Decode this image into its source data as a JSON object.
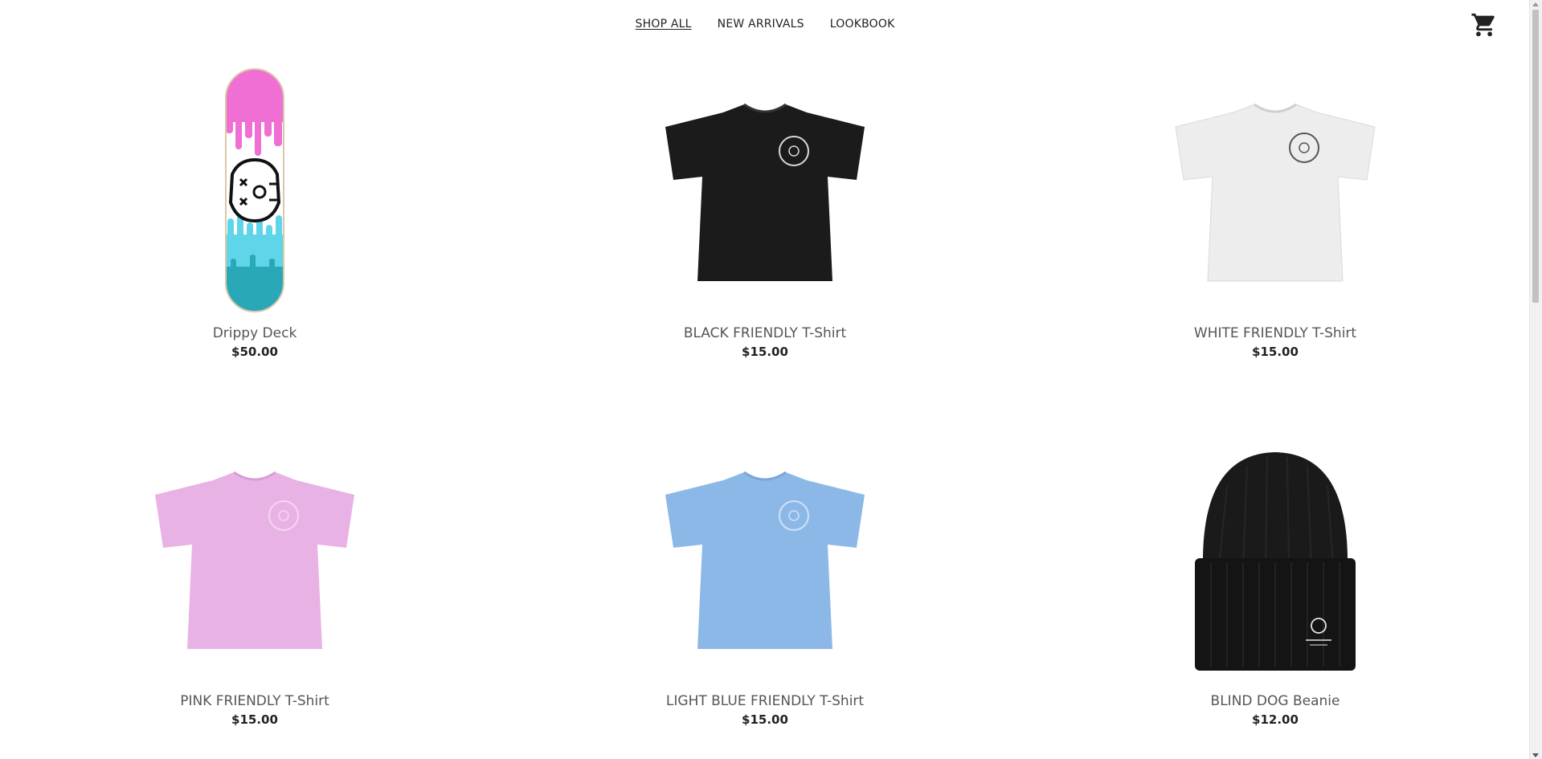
{
  "nav": {
    "items": [
      {
        "label": "SHOP ALL",
        "active": true
      },
      {
        "label": "NEW ARRIVALS",
        "active": false
      },
      {
        "label": "LOOKBOOK",
        "active": false
      }
    ],
    "cart_icon": "shopping-cart-icon"
  },
  "products": [
    {
      "name": "Drippy Deck",
      "price": "$50.00",
      "image": "skateboard-deck",
      "color": "#f06fd4"
    },
    {
      "name": "BLACK FRIENDLY T-Shirt",
      "price": "$15.00",
      "image": "tshirt",
      "color": "#1b1b1b"
    },
    {
      "name": "WHITE FRIENDLY T-Shirt",
      "price": "$15.00",
      "image": "tshirt",
      "color": "#ececec"
    },
    {
      "name": "PINK FRIENDLY T-Shirt",
      "price": "$15.00",
      "image": "tshirt",
      "color": "#e9b2e4"
    },
    {
      "name": "LIGHT BLUE FRIENDLY T-Shirt",
      "price": "$15.00",
      "image": "tshirt",
      "color": "#8cb8e8"
    },
    {
      "name": "BLIND DOG Beanie",
      "price": "$12.00",
      "image": "beanie",
      "color": "#151515"
    }
  ]
}
